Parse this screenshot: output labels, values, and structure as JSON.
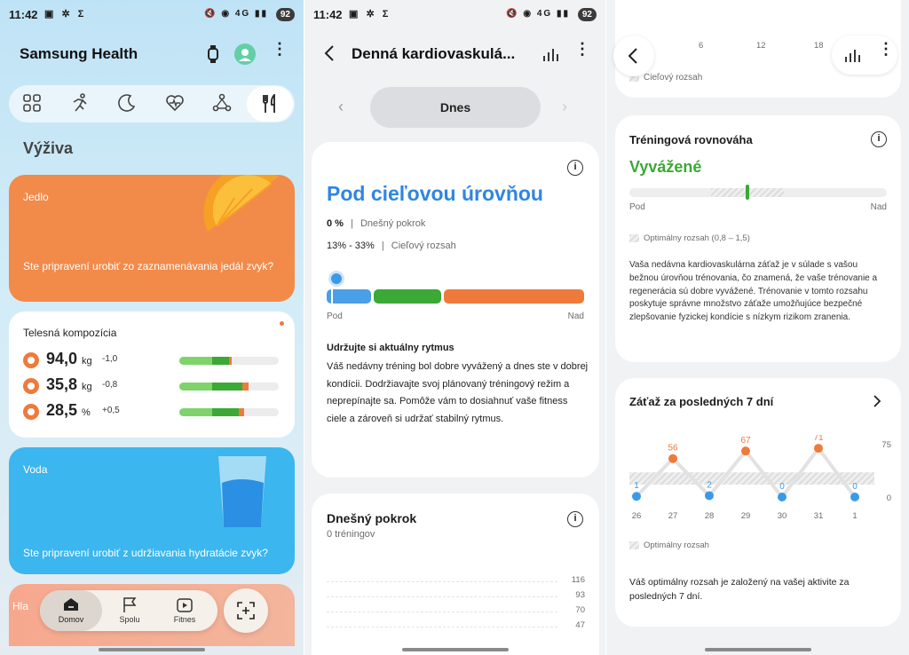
{
  "statusbar": {
    "time": "11:42",
    "left_icons": "▣ ✲ Σ",
    "right_icons": "🔇 ◉ 4G ▮▮",
    "battery": "92"
  },
  "screen1": {
    "app_title": "Samsung Health",
    "section_title": "Výživa",
    "food_card": {
      "label": "Jedlo",
      "text": "Ste pripravení urobiť zo zaznamenávania jedál zvyk?"
    },
    "body_card": {
      "title": "Telesná kompozícia",
      "rows": [
        {
          "value": "94,0",
          "unit": "kg",
          "delta": "-1,0",
          "green": 0.5,
          "orange": 0.03
        },
        {
          "value": "35,8",
          "unit": "kg",
          "delta": "-0,8",
          "green": 0.63,
          "orange": 0.06
        },
        {
          "value": "28,5",
          "unit": "%",
          "delta": "+0,5",
          "green": 0.6,
          "orange": 0.05
        }
      ]
    },
    "water_card": {
      "label": "Voda",
      "text": "Ste pripravení urobiť z udržiavania hydratácie zvyk?"
    },
    "bottom_card_label": "Hla",
    "nav": {
      "home": "Domov",
      "together": "Spolu",
      "fitness": "Fitnes"
    }
  },
  "screen2": {
    "title": "Denná kardiovaskulá...",
    "date": "Dnes",
    "status": "Pod cieľovou úrovňou",
    "progress_value": "0 %",
    "progress_label": "Dnešný pokrok",
    "range_value": "13% - 33%",
    "range_label": "Cieľový rozsah",
    "scale_low": "Pod",
    "scale_high": "Nad",
    "advice_title": "Udržujte si aktuálny rytmus",
    "advice_text": "Váš nedávny tréning bol dobre vyvážený a dnes ste v dobrej kondícii. Dodržiavajte svoj plánovaný tréningový režim a neprepínajte sa. Pomôže vám to dosiahnuť vaše fitness ciele a zároveň si udržať stabilný rytmus.",
    "today_title": "Dnešný pokrok",
    "today_sub": "0 tréningov",
    "today_ticks": [
      "116",
      "93",
      "70",
      "47"
    ]
  },
  "screen3": {
    "top_axis": [
      "6",
      "12",
      "18"
    ],
    "top_legend": "Cieľový rozsah",
    "balance_title": "Tréningová rovnováha",
    "balance_status": "Vyvážené",
    "balance_low": "Pod",
    "balance_high": "Nad",
    "balance_legend": "Optimálny rozsah (0,8 – 1,5)",
    "balance_text": "Vaša nedávna kardiovaskulárna záťaž je v súlade s vašou bežnou úrovňou trénovania, čo znamená, že vaše trénovanie a regenerácia sú dobre vyvážené. Trénovanie v tomto rozsahu poskytuje správne množstvo záťaže umožňujúce bezpečné zlepšovanie fyzickej kondície s nízkym rizikom zranenia.",
    "load_title": "Záťaž za posledných 7 dní",
    "load_legend": "Optimálny rozsah",
    "load_text": "Váš optimálny rozsah je založený na vašej aktivite za posledných 7 dní.",
    "colors": {
      "low": "#3b9ae8",
      "high": "#ee7a3c",
      "good": "#3aa935"
    }
  },
  "chart_data": {
    "type": "line",
    "title": "Záťaž za posledných 7 dní",
    "categories": [
      "26",
      "27",
      "28",
      "29",
      "30",
      "31",
      "1"
    ],
    "values": [
      1,
      56,
      2,
      67,
      0,
      71,
      0
    ],
    "y_ticks": [
      "75",
      "0"
    ],
    "ylim": [
      0,
      75
    ],
    "optimal_band": [
      18,
      36
    ],
    "legend": "Optimálny rozsah",
    "grid": false
  }
}
